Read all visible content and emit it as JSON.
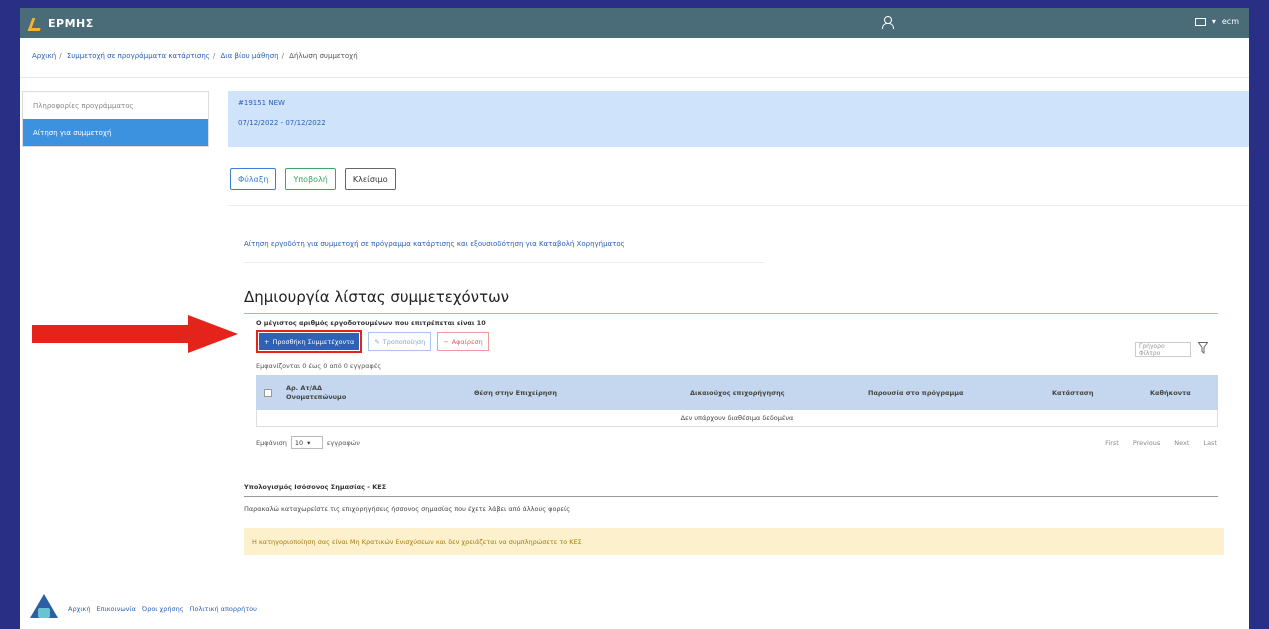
{
  "app": {
    "title": "ΕΡΜΗΣ",
    "user_label": "ecm"
  },
  "breadcrumb": [
    "Αρχική",
    "Συμμετοχή σε προγράμματα κατάρτισης",
    "Δια βίου μάθηση",
    "Δήλωση συμμετοχή"
  ],
  "sidebar": {
    "items": [
      {
        "label": "Πληροφορίες προγράμματος",
        "active": false
      },
      {
        "label": "Αίτηση για συμμετοχή",
        "active": true
      }
    ]
  },
  "banner": {
    "code": "#19151 NEW",
    "dates": "07/12/2022 - 07/12/2022"
  },
  "actions": {
    "save": "Φύλαξη",
    "submit": "Υποβολή",
    "close": "Κλείσιμο"
  },
  "link_title": "Αίτηση εργοδότη για συμμετοχή σε πρόγραμμα κατάρτισης και εξουσιοδότηση για Καταβολή Χορηγήματος",
  "participants": {
    "title": "Δημιουργία λίστας συμμετεχόντων",
    "max_note": "Ο μέγιστος αριθμός εργοδοτουμένων που επιτρέπεται είναι 10",
    "add_label": "Προσθήκη Συμμετέχοντα",
    "edit_label": "Τροποποίηση",
    "delete_label": "Αφαίρεση",
    "filter_placeholder": "Γρήγορο Φίλτρο",
    "showing": "Εμφανίζονται 0 έως 0 από 0 εγγραφές",
    "columns": [
      "Αρ. Ατ/ΑΔ Ονοματεπώνυμο",
      "Θέση στην Επιχείρηση",
      "Δικαιούχος επιχορήγησης",
      "Παρουσία στο πρόγραμμα",
      "Κατάσταση",
      "Καθήκοντα"
    ],
    "empty_text": "Δεν υπάρχουν διαθέσιμα δεδομένα",
    "per_page_prefix": "Εμφάνιση",
    "per_page_value": "10",
    "per_page_suffix": "εγγραφών",
    "pager": [
      "First",
      "Previous",
      "Next",
      "Last"
    ]
  },
  "calculation": {
    "title": "Υπολογισμός Ισόσονος Σημασίας - ΚΕΣ",
    "note": "Παρακαλώ καταχωρείστε τις επιχορηγήσεις ήσσονος σημασίας που έχετε λάβει από άλλους φορείς",
    "warning": "Η κατηγοριοποίηση σας είναι Μη Κρατικών Ενισχύσεων και δεν χρειάζεται να συμπληρώσετε το ΚΕΣ"
  },
  "footer": {
    "links": [
      "Αρχική",
      "Επικοινωνία",
      "Όροι χρήσης",
      "Πολιτική απορρήτου"
    ]
  },
  "colors": {
    "frame": "#2a2f86",
    "topbar": "#4a6b78",
    "primary": "#2d62b4",
    "highlight": "#e4231a",
    "banner": "#cfe3fb",
    "warning_bg": "#fcf1cc"
  }
}
